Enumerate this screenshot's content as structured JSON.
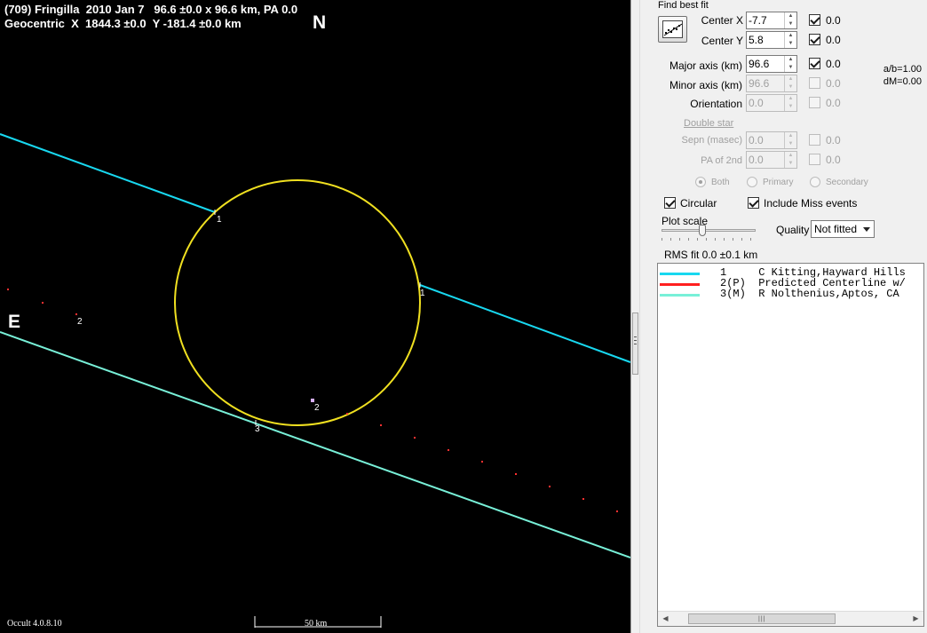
{
  "plot": {
    "title_line1": "(709) Fringilla  2010 Jan 7   96.6 ±0.0 x 96.6 km, PA 0.0",
    "title_line2": "Geocentric  X  1844.3 ±0.0  Y -181.4 ±0.0 km",
    "north": "N",
    "east": "E",
    "scale_label": "50 km",
    "version": "Occult 4.0.8.10",
    "chord_labels": [
      "1",
      "1",
      "2",
      "2",
      "3"
    ],
    "colors": {
      "background": "#000000",
      "ellipse": "#f0e020",
      "chord1": "#18d8f0",
      "chord3": "#78f0d8",
      "predicted": "#ff3030"
    }
  },
  "panel": {
    "find_best_fit": "Find best fit",
    "center_x": {
      "label": "Center X",
      "value": "-7.7",
      "checked": true,
      "uncert": "0.0"
    },
    "center_y": {
      "label": "Center Y",
      "value": "5.8",
      "checked": true,
      "uncert": "0.0"
    },
    "major_axis": {
      "label": "Major axis (km)",
      "value": "96.6",
      "checked": true,
      "uncert": "0.0"
    },
    "minor_axis": {
      "label": "Minor axis (km)",
      "value": "96.6",
      "checked": false,
      "uncert": "0.0"
    },
    "orientation": {
      "label": "Orientation",
      "value": "0.0",
      "checked": false,
      "uncert": "0.0"
    },
    "ratio": "a/b=1.00",
    "dmag": "dM=0.00",
    "double_star": "Double star",
    "sepn": {
      "label": "Sepn (masec)",
      "value": "0.0",
      "checked": false,
      "uncert": "0.0"
    },
    "pa2": {
      "label": "PA of 2nd",
      "value": "0.0",
      "checked": false,
      "uncert": "0.0"
    },
    "radio_both": "Both",
    "radio_primary": "Primary",
    "radio_secondary": "Secondary",
    "circular": {
      "label": "Circular",
      "checked": true
    },
    "include_miss": {
      "label": "Include Miss events",
      "checked": true
    },
    "plot_scale": "Plot scale",
    "quality_label": "Quality",
    "quality_value": "Not fitted",
    "rms": "RMS fit 0.0 ±0.1 km"
  },
  "legend": [
    {
      "num": "1   ",
      "text": "C Kitting,Hayward Hills",
      "color": "#18d8f0"
    },
    {
      "num": "2(P)",
      "text": "Predicted Centerline w/",
      "color": "#ff2020"
    },
    {
      "num": "3(M)",
      "text": "R Nolthenius,Aptos, CA",
      "color": "#78f0d8"
    }
  ]
}
